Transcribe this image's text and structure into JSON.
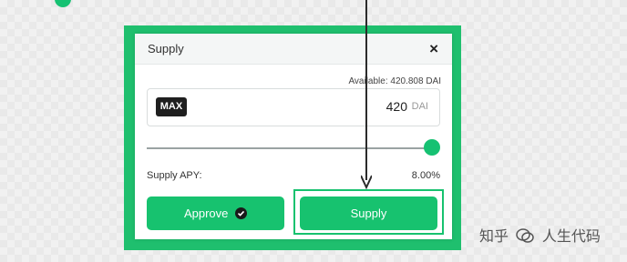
{
  "modal": {
    "title": "Supply",
    "close_glyph": "×",
    "available_label": "Available: 420.808 DAI"
  },
  "amount_input": {
    "max_label": "MAX",
    "value": "420",
    "unit": "DAI"
  },
  "slider": {
    "value_fraction": 0.998
  },
  "apy": {
    "label": "Supply APY:",
    "value": "8.00%"
  },
  "buttons": {
    "approve_label": "Approve",
    "supply_label": "Supply"
  },
  "icons": {
    "approve_check": "check-circle-icon",
    "close": "close-icon",
    "arrow": "arrow-down-icon"
  },
  "watermark": {
    "part1": "知乎",
    "part2": "人生代码"
  },
  "colors": {
    "accent": "#16c172",
    "frame": "#1fbf6e",
    "max_button": "#1f1f1f"
  }
}
